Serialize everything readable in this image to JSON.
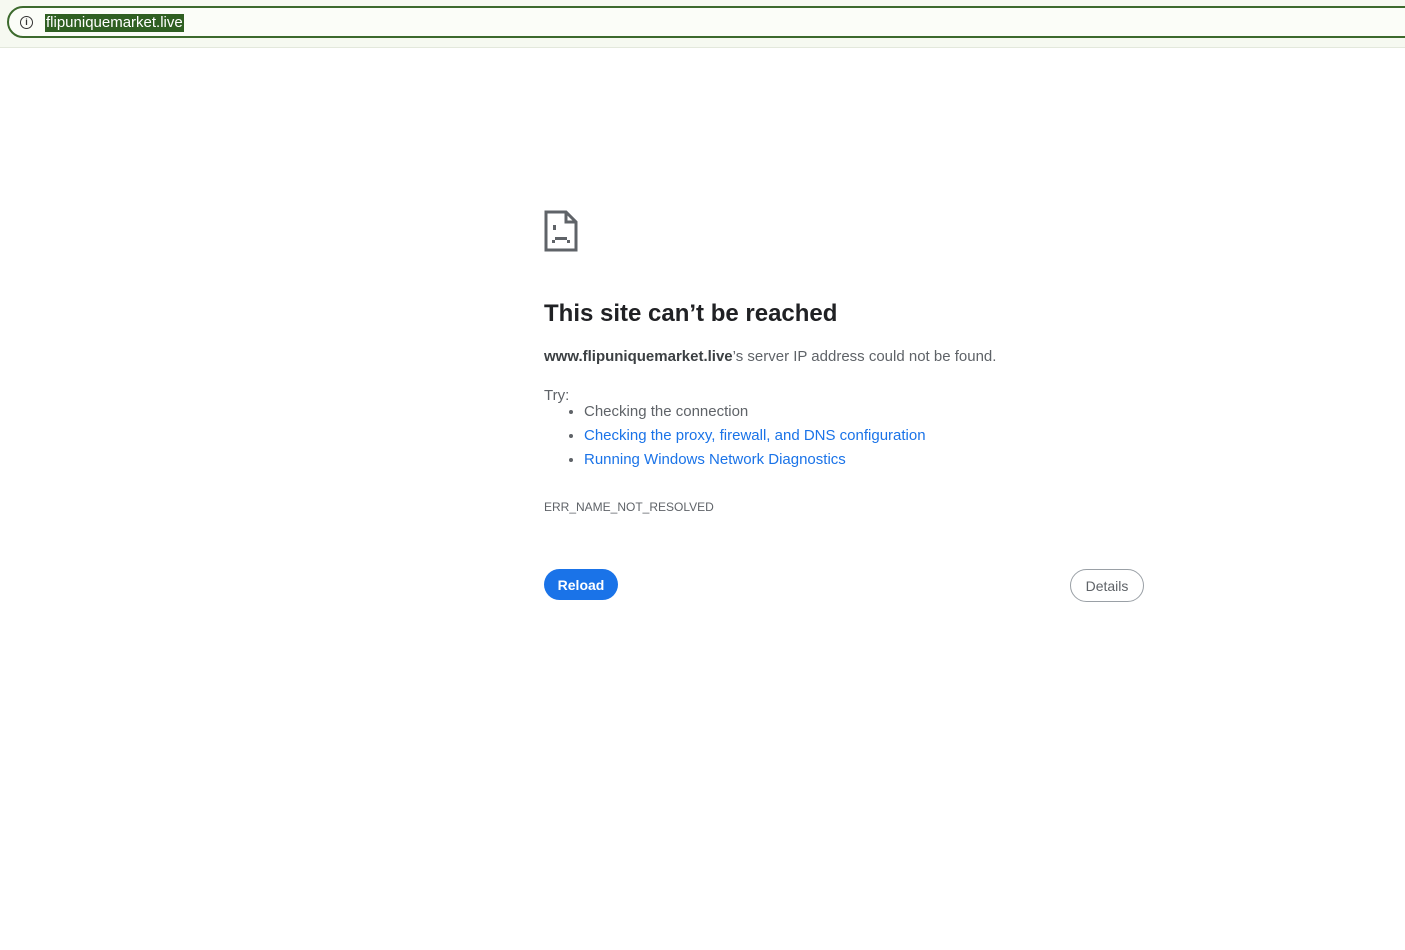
{
  "address_bar": {
    "url": "flipuniquemarket.live",
    "icon": "info-icon"
  },
  "error": {
    "icon": "sad-page-icon",
    "title": "This site can’t be reached",
    "host": "www.flipuniquemarket.live",
    "message_suffix": "’s server IP address could not be found.",
    "try_label": "Try:",
    "suggestions": [
      "Checking the connection",
      "Checking the proxy, firewall, and DNS configuration",
      "Running Windows Network Diagnostics"
    ],
    "code": "ERR_NAME_NOT_RESOLVED"
  },
  "buttons": {
    "reload": "Reload",
    "details": "Details"
  },
  "colors": {
    "accent": "#1a73e8",
    "omnibox_border": "#3c6a2d",
    "selection": "#2f5f22"
  }
}
